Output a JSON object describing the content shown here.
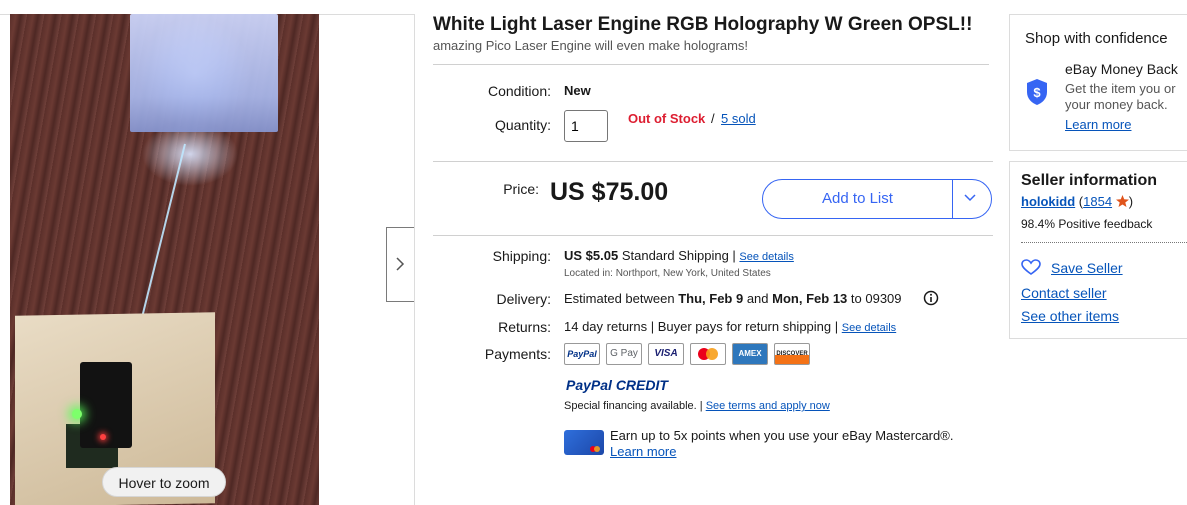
{
  "gallery": {
    "zoom_hint": "Hover to zoom"
  },
  "item": {
    "title": "White Light Laser Engine RGB Holography W Green OPSL!!",
    "subtitle": "amazing Pico Laser Engine will even make holograms!",
    "condition_label": "Condition:",
    "condition_value": "New",
    "quantity_label": "Quantity:",
    "quantity_value": "1",
    "stock_status": "Out of Stock",
    "stock_sep": "/",
    "sold_link": "5 sold",
    "price_label": "Price:",
    "price": "US $75.00",
    "add_to_list": "Add to List"
  },
  "shipping": {
    "label": "Shipping:",
    "cost": "US $5.05",
    "method": "Standard Shipping |",
    "details_link": "See details",
    "location": "Located in: Northport, New York, United States"
  },
  "delivery": {
    "label": "Delivery:",
    "prefix": "Estimated between",
    "date_start": "Thu, Feb 9",
    "and": "and",
    "date_end": "Mon, Feb 13",
    "to_zip": "to 09309"
  },
  "returns": {
    "label": "Returns:",
    "text": "14 day returns | Buyer pays for return shipping |",
    "details_link": "See details"
  },
  "payments": {
    "label": "Payments:",
    "methods": [
      "PayPal",
      "G Pay",
      "VISA",
      "Mastercard",
      "AMEX",
      "DISCOVER"
    ],
    "paypal_credit": "PayPal CREDIT",
    "financing_text": "Special financing available. |",
    "financing_link": "See terms and apply now",
    "mastercard_offer": "Earn up to 5x points when you use your eBay Mastercard®.",
    "learn_more": "Learn more"
  },
  "confidence": {
    "title": "Shop with confidence",
    "guarantee_title": "eBay Money Back",
    "guarantee_line1": "Get the item you or",
    "guarantee_line2": "your money back.",
    "learn_more": "Learn more"
  },
  "seller": {
    "title": "Seller information",
    "name": "holokidd",
    "open_paren": "(",
    "feedback_count": "1854",
    "close_paren": ")",
    "positive": "98.4% Positive feedback",
    "save": "Save Seller",
    "contact": "Contact seller",
    "other": "See other items"
  },
  "colors": {
    "link": "#0654ba",
    "accent_blue": "#3665f3",
    "out_of_stock": "#dd1e31",
    "star": "#e0541b"
  }
}
